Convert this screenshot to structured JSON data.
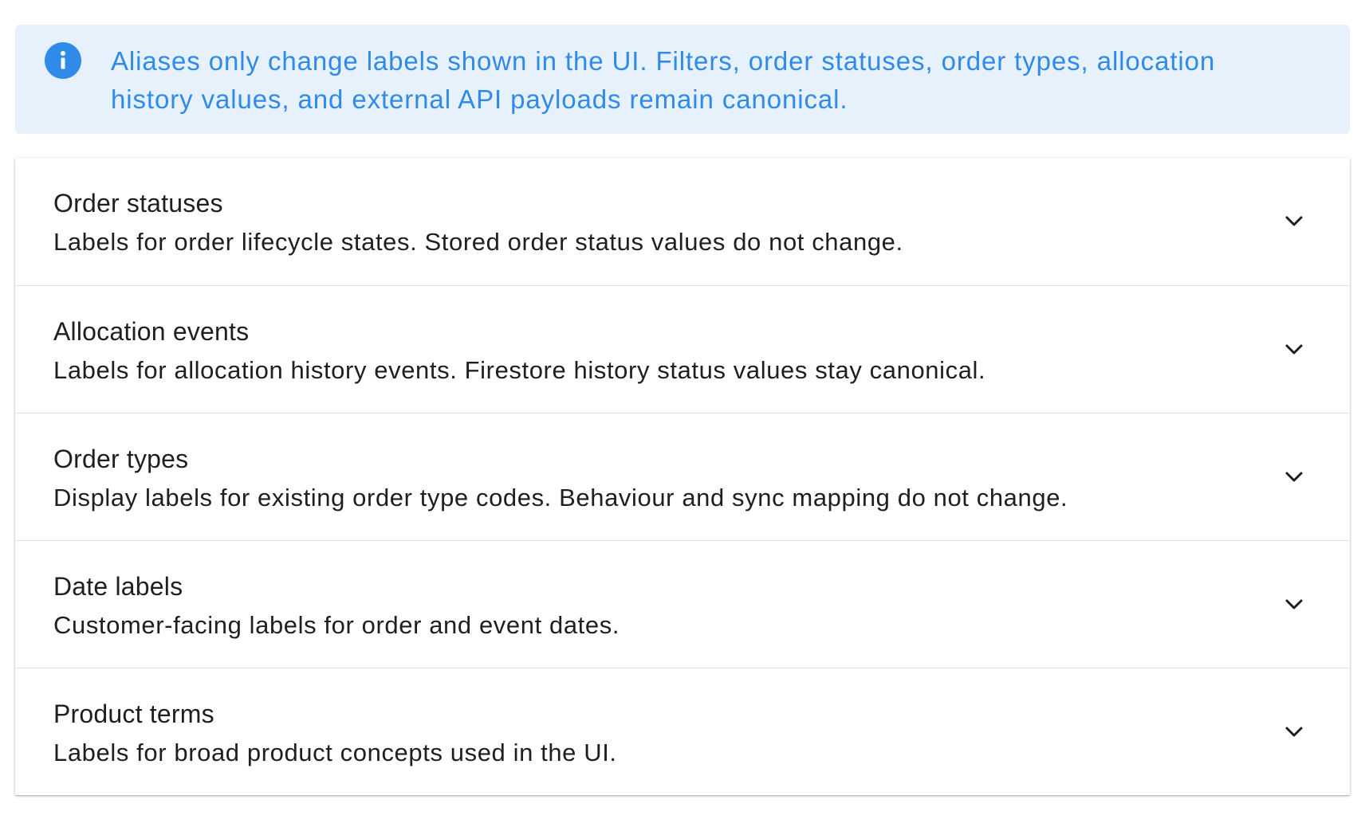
{
  "banner": {
    "icon": "info-icon",
    "color": "#2f8ae8",
    "background": "#e6f1fc",
    "text": "Aliases only change labels shown in the UI. Filters, order statuses, order types, allocation history values, and external API payloads remain canonical."
  },
  "sections": [
    {
      "title": "Order statuses",
      "description": "Labels for order lifecycle states. Stored order status values do not change.",
      "icon": "chevron-down-icon"
    },
    {
      "title": "Allocation events",
      "description": "Labels for allocation history events. Firestore history status values stay canonical.",
      "icon": "chevron-down-icon"
    },
    {
      "title": "Order types",
      "description": "Display labels for existing order type codes. Behaviour and sync mapping do not change.",
      "icon": "chevron-down-icon"
    },
    {
      "title": "Date labels",
      "description": "Customer-facing labels for order and event dates.",
      "icon": "chevron-down-icon"
    },
    {
      "title": "Product terms",
      "description": "Labels for broad product concepts used in the UI.",
      "icon": "chevron-down-icon"
    }
  ]
}
